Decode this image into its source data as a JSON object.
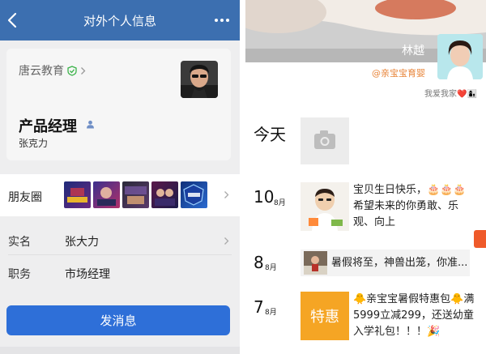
{
  "left": {
    "nav": {
      "title": "对外个人信息"
    },
    "card": {
      "company": "唐云教育",
      "job_title": "产品经理",
      "name": "张克力"
    },
    "moments": {
      "label": "朋友圈",
      "thumb_count": 5
    },
    "rows": [
      {
        "label": "实名",
        "value": "张大力"
      },
      {
        "label": "职务",
        "value": "市场经理"
      }
    ],
    "send_button": "发消息",
    "colors": {
      "topbar": "#3c6fb0",
      "button": "#2e6fd8",
      "verified": "#3bb34a"
    }
  },
  "right": {
    "cover_name": "林越",
    "channel": "@亲宝宝育婴",
    "signature": "我爱我家❤️👩‍👦",
    "today_label": "今天",
    "posts": [
      {
        "day": "10",
        "month": "8月",
        "text": "宝贝生日快乐，🎂🎂🎂希望未来的你勇敢、乐观、向上"
      },
      {
        "day": "8",
        "month": "8月",
        "text": "暑假将至，神兽出笼，你准..."
      },
      {
        "day": "7",
        "month": "8月",
        "badge": "特惠",
        "text": "🐥亲宝宝暑假特惠包🐥满5999立减299，还送幼童入学礼包！！！🎉"
      }
    ],
    "icons": [
      "camera-icon"
    ]
  }
}
